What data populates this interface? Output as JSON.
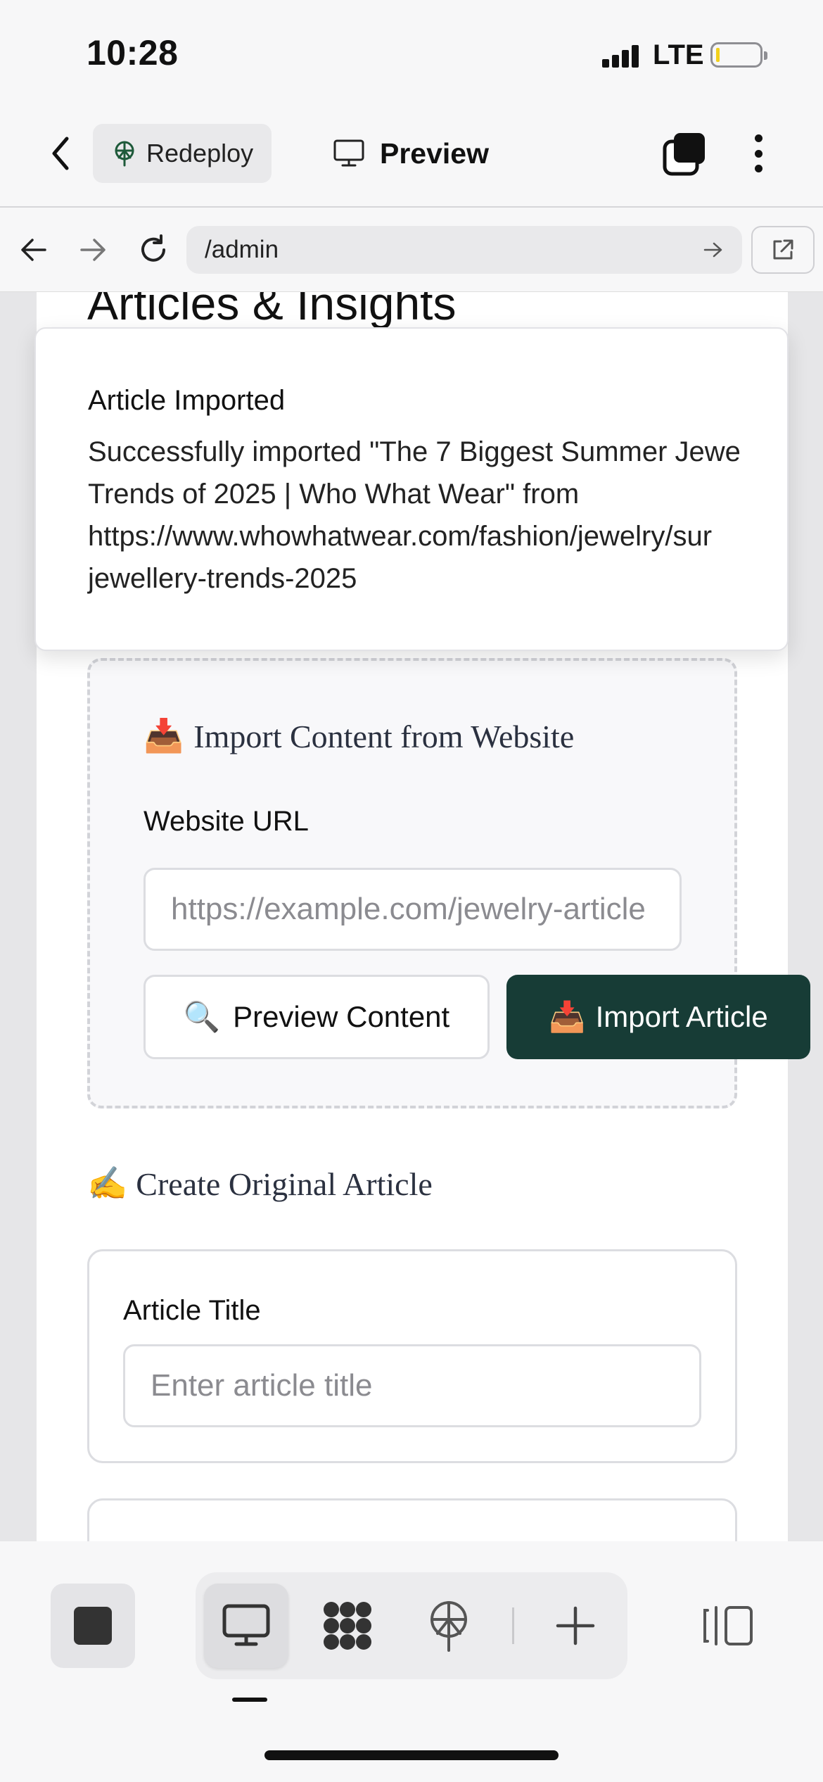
{
  "status_bar": {
    "time": "10:28",
    "network": "LTE"
  },
  "app_bar": {
    "redeploy_label": "Redeploy",
    "preview_label": "Preview",
    "icons": [
      "chevron-left-icon",
      "redeploy-icon",
      "monitor-icon",
      "tabs-icon",
      "more-vertical-icon"
    ]
  },
  "browser_bar": {
    "url": "/admin",
    "icons": [
      "back-arrow-icon",
      "forward-arrow-icon",
      "reload-icon",
      "go-arrow-icon",
      "external-link-icon"
    ]
  },
  "page": {
    "heading": "Articles & Insights",
    "import_section": {
      "emoji": "📥",
      "heading": "Import Content from Website",
      "url_label": "Website URL",
      "url_placeholder": "https://example.com/jewelry-article",
      "preview_button_emoji": "🔍",
      "preview_button": "Preview Content",
      "import_button_emoji": "📥",
      "import_button": "Import Article"
    },
    "create_section": {
      "emoji": "✍️",
      "heading": "Create Original Article",
      "title_label": "Article Title",
      "title_placeholder": "Enter article title"
    }
  },
  "toast": {
    "title": "Article Imported",
    "lines": [
      "Successfully imported \"The 7 Biggest Summer Jewe",
      "Trends of 2025 | Who What Wear\" from",
      "https://www.whowhatwear.com/fashion/jewelry/sur",
      "jewellery-trends-2025"
    ]
  },
  "bottom_toolbar": {
    "icons": [
      "stop-icon",
      "desktop-preview-icon",
      "apps-grid-icon",
      "deploy-icon",
      "add-icon",
      "panel-toggle-icon"
    ]
  },
  "colors": {
    "accent_dark_green": "#173c36",
    "background": "#f7f7f8",
    "redeploy_icon": "#1e5a3a"
  }
}
